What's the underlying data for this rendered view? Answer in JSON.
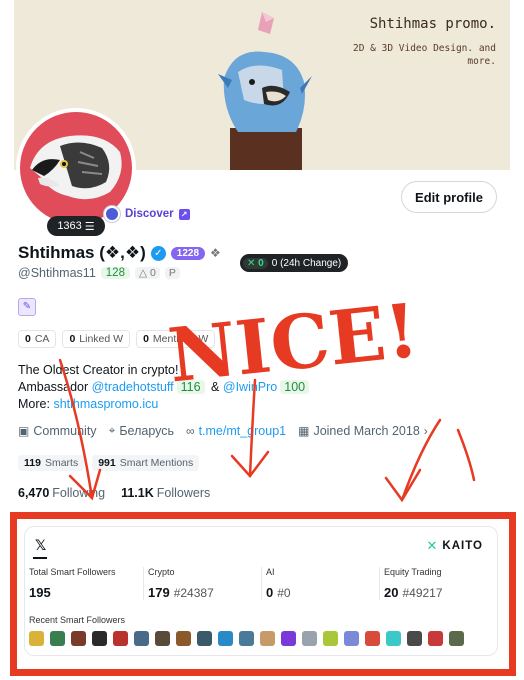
{
  "banner": {
    "title": "Shtihmas promo.",
    "subtitle": "2D & 3D Video Design. and more."
  },
  "avatar": {
    "badge_value": "1363",
    "badge_icon": "kaito-stack-icon"
  },
  "discover": {
    "label": "Discover"
  },
  "profile": {
    "edit_label": "Edit profile",
    "name": "Shtihmas (❖,❖)",
    "badge_value": "1228",
    "handle": "@Shtihmas11",
    "handle_score": "128",
    "handle_sub": "0",
    "change_x": "0",
    "change_text": "0 (24h Change)"
  },
  "chips": [
    {
      "count": "0",
      "label": "CA"
    },
    {
      "count": "0",
      "label": "Linked W"
    },
    {
      "count": "0",
      "label": "Mentions W"
    }
  ],
  "bio": {
    "line1": "The Oldest Creator in crypto!",
    "line2_prefix": "Ambassador",
    "mention1": "@tradehotstuff",
    "mention1_score": "116",
    "amp": "&",
    "mention2": "@IwinPro",
    "mention2_score": "100",
    "line3_prefix": "More:",
    "url": "shtihmaspromo.icu"
  },
  "meta": {
    "community": "Community",
    "location": "Беларусь",
    "link": "t.me/mt_group1",
    "joined": "Joined March 2018"
  },
  "smart": [
    {
      "count": "119",
      "label": "Smarts"
    },
    {
      "count": "991",
      "label": "Smart Mentions"
    }
  ],
  "follow": {
    "following_count": "6,470",
    "following_label": "Following",
    "followers_count": "11.1K",
    "followers_label": "Followers"
  },
  "annotation": {
    "text": "NICE!"
  },
  "kaito": {
    "x_logo": "𝕏",
    "brand": "KAITO",
    "stats": [
      {
        "label": "Total Smart Followers",
        "value": "195",
        "rank": ""
      },
      {
        "label": "Crypto",
        "value": "179",
        "rank": "#24387"
      },
      {
        "label": "AI",
        "value": "0",
        "rank": "#0"
      },
      {
        "label": "Equity Trading",
        "value": "20",
        "rank": "#49217"
      }
    ],
    "recent_label": "Recent Smart Followers",
    "avatar_colors": [
      "#d9b23a",
      "#3a7d4f",
      "#7a3a2a",
      "#2a2a2a",
      "#b8322e",
      "#4a6a8a",
      "#5a4a3a",
      "#8a5a2a",
      "#3a5a6a",
      "#2a8ac8",
      "#4a7a9a",
      "#c89a6a",
      "#7a3ad8",
      "#9aa3ad",
      "#a8c83a",
      "#7a8ad8",
      "#d84a3a",
      "#3ac8c8",
      "#4a4a4a",
      "#c83a3a",
      "#5a6a4a"
    ]
  }
}
